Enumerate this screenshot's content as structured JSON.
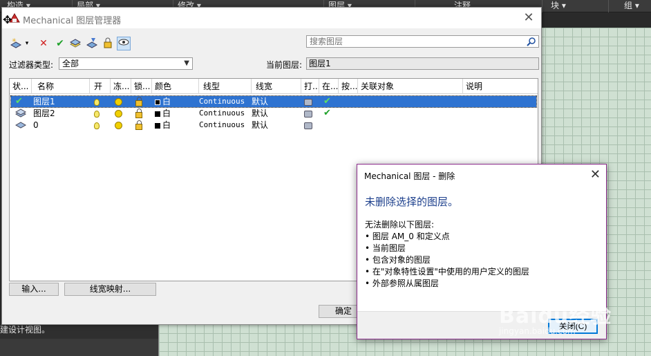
{
  "ribbon": {
    "items": [
      "构造 ▾",
      "局部 ▾",
      "修改 ▾",
      "图层 ▾",
      "注释",
      "块 ▾",
      "组 ▾"
    ]
  },
  "background": {
    "left_panel_text": "建设计视图。"
  },
  "layer_manager": {
    "title": "Mechanical 图层管理器",
    "search_placeholder": "搜索图层",
    "filter_label": "过滤器类型:",
    "filter_value": "全部",
    "current_layer_label": "当前图层:",
    "current_layer_value": "图层1",
    "columns": [
      "状...",
      "名称",
      "开",
      "冻...",
      "锁...",
      "颜色",
      "线型",
      "线宽",
      "打...",
      "在...",
      "按...",
      "关联对象",
      "说明"
    ],
    "rows": [
      {
        "name": "图层1",
        "color": "白",
        "linetype": "Continuous",
        "lineweight": "默认",
        "selected": true,
        "current": true,
        "in_use": true
      },
      {
        "name": "图层2",
        "color": "白",
        "linetype": "Continuous",
        "lineweight": "默认",
        "selected": false,
        "current": false,
        "in_use": true
      },
      {
        "name": "0",
        "color": "白",
        "linetype": "Continuous",
        "lineweight": "默认",
        "selected": false,
        "current": false,
        "in_use": false
      }
    ],
    "buttons": {
      "import": "输入...",
      "lineweight_map": "线宽映射...",
      "ok": "确定"
    }
  },
  "delete_dialog": {
    "title": "Mechanical 图层 - 删除",
    "main_instruction": "未删除选择的图层。",
    "sub_text": "无法删除以下图层:",
    "reasons": [
      "• 图层 AM_0 和定义点",
      "• 当前图层",
      "• 包含对象的图层",
      "• 在\"对象特性设置\"中使用的用户定义的图层",
      "• 外部参照从属图层"
    ],
    "close_button": "关闭(C)"
  },
  "watermark": {
    "text": "Baidu经验",
    "sub": "jingyan.baidu.com"
  },
  "colors": {
    "selection": "#2e73d1",
    "dialog_heading": "#1c3f8c",
    "dialog_border": "#8c2b8c",
    "grid_bg": "#cfe0d2"
  }
}
